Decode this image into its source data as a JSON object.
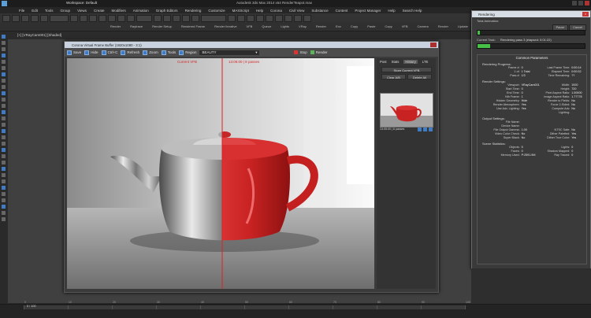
{
  "app": {
    "title": "Workspace: Default",
    "window_title": "Autodesk 3ds Max 2014 x64   RenderTeapot.max"
  },
  "menubar": [
    "File",
    "Edit",
    "Tools",
    "Group",
    "Views",
    "Create",
    "Modifiers",
    "Animation",
    "Graph Editors",
    "Rendering",
    "Customize",
    "MAXScript",
    "Help",
    "Corona",
    "Civil View",
    "Substance",
    "Content",
    "Project Manager",
    "Help",
    "Search Help"
  ],
  "toolbar2": [
    "Render",
    "Raytrace",
    "Render Setup",
    "Rendered Frame",
    "Render Iterative",
    "VFB",
    "Queue",
    "Lights",
    "VRay",
    "Render",
    "Env",
    "Copy",
    "Paste",
    "Copy",
    "VFB",
    "Camera",
    "Render",
    "Update",
    "Sample",
    "Options",
    "Reset",
    "Transform"
  ],
  "viewport_label": "[+] [VRayCam001] [Shaded]",
  "vfb": {
    "title": "Corona Virtual Frame Buffer (1920x1080 - 3:1)",
    "toolbar": [
      {
        "label": "Save"
      },
      {
        "label": "Hide"
      },
      {
        "label": "Ctrl+C"
      },
      {
        "label": "Refresh"
      },
      {
        "label": "Zoom"
      },
      {
        "label": "Tools"
      },
      {
        "label": "Region"
      }
    ],
    "channel": "BEAUTY",
    "compare_left": "Current VFB",
    "compare_right": "13:05:00 | 8 passes",
    "history_tabs": [
      "Post",
      "Stats",
      "History",
      "LTE"
    ],
    "history_buttons": [
      "Store Current VFB",
      "Clear A/B",
      "Delete All"
    ],
    "history_active_tab": "History",
    "stop_label": "Stop",
    "render_label": "Render",
    "thumb_label": "13:05:00 | 8 passes",
    "accent_color": "#d32a2a"
  },
  "rendering": {
    "title": "Rendering",
    "pause_label": "Pause",
    "cancel_label": "Cancel",
    "total_animation_label": "Total Animation:",
    "current_task_label": "Current Task:",
    "current_task_value": "Rendering pass 3 (elapsed: 0:01:22)",
    "progress_total": 0.02,
    "progress_current": 0.12,
    "common_params_title": "Common Parameters",
    "rendering_progress": "Rendering Progress:",
    "progress_rows": [
      {
        "k": "Frame #:",
        "v": "0",
        "k2": "Last Frame Time:",
        "v2": "0:00:14"
      },
      {
        "k": "1 of:",
        "v": "1 Total",
        "k2": "Elapsed Time:",
        "v2": "0:00:32"
      },
      {
        "k": "Pass #:",
        "v": "1/3",
        "k2": "Time Remaining:",
        "v2": "??"
      }
    ],
    "render_settings": "Render Settings:",
    "settings_rows": [
      {
        "k": "Viewport:",
        "v": "VRayCam001",
        "k2": "Width:",
        "v2": "1920"
      },
      {
        "k": "Start Time:",
        "v": "0",
        "k2": "Height:",
        "v2": "720"
      },
      {
        "k": "End Time:",
        "v": "0",
        "k2": "Pixel Aspect Ratio:",
        "v2": "1.00000"
      },
      {
        "k": "Nth Frame:",
        "v": "1",
        "k2": "Image Aspect Ratio:",
        "v2": "1.77778"
      },
      {
        "k": "Hidden Geometry:",
        "v": "Hide",
        "k2": "Render to Fields:",
        "v2": "No"
      },
      {
        "k": "Render Atmosphere:",
        "v": "Yes",
        "k2": "Force 2-Sided:",
        "v2": "No"
      },
      {
        "k": "Use Adv. Lighting:",
        "v": "Yes",
        "k2": "Compute Adv. Lighting:",
        "v2": "No"
      }
    ],
    "output_settings": "Output Settings:",
    "output_rows": [
      {
        "k": "File Name:",
        "v": "",
        "k2": "",
        "v2": ""
      },
      {
        "k": "Device Name:",
        "v": "",
        "k2": "",
        "v2": ""
      },
      {
        "k": "File Output Gamma:",
        "v": "1.00",
        "k2": "NTSC Safe:",
        "v2": "No"
      },
      {
        "k": "Video Color Check:",
        "v": "No",
        "k2": "Dither Paletted:",
        "v2": "Yes"
      },
      {
        "k": "Super Black:",
        "v": "No",
        "k2": "Dither True Color:",
        "v2": "Yes"
      }
    ],
    "scene_stats": "Scene Statistics:",
    "stats_rows": [
      {
        "k": "Objects:",
        "v": "5",
        "k2": "Lights:",
        "v2": "0"
      },
      {
        "k": "Faces:",
        "v": "0",
        "k2": "Shadow Mapped:",
        "v2": "0"
      },
      {
        "k": "Memory Used:",
        "v": "P:2591.9M",
        "k2": "Ray Traced:",
        "v2": "0"
      }
    ]
  },
  "timeline": {
    "frame_label": "0 / 100",
    "ticks": [
      "0",
      "10",
      "20",
      "30",
      "40",
      "50",
      "60",
      "70",
      "80",
      "90",
      "100"
    ]
  }
}
